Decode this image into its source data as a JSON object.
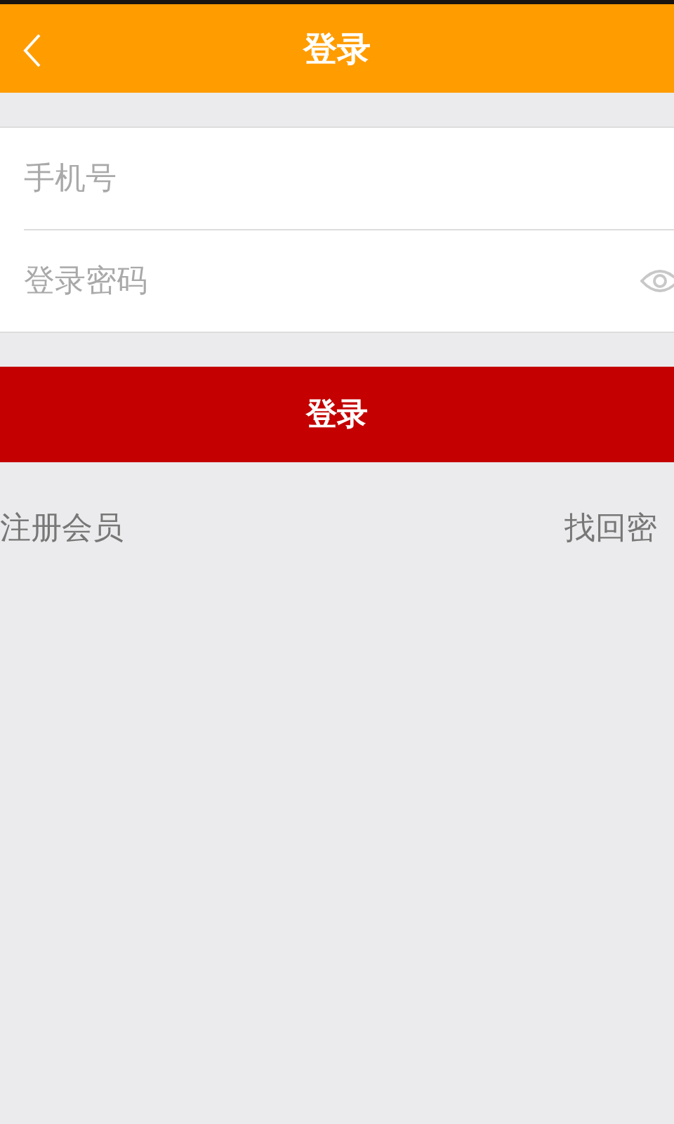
{
  "header": {
    "title": "登录"
  },
  "fields": [
    {
      "kind": "text",
      "placeholder": "手机号"
    },
    {
      "kind": "password",
      "placeholder": "登录密码"
    }
  ],
  "login_button": "登录",
  "links": {
    "register": "注册会员",
    "forgot": "找回密"
  }
}
